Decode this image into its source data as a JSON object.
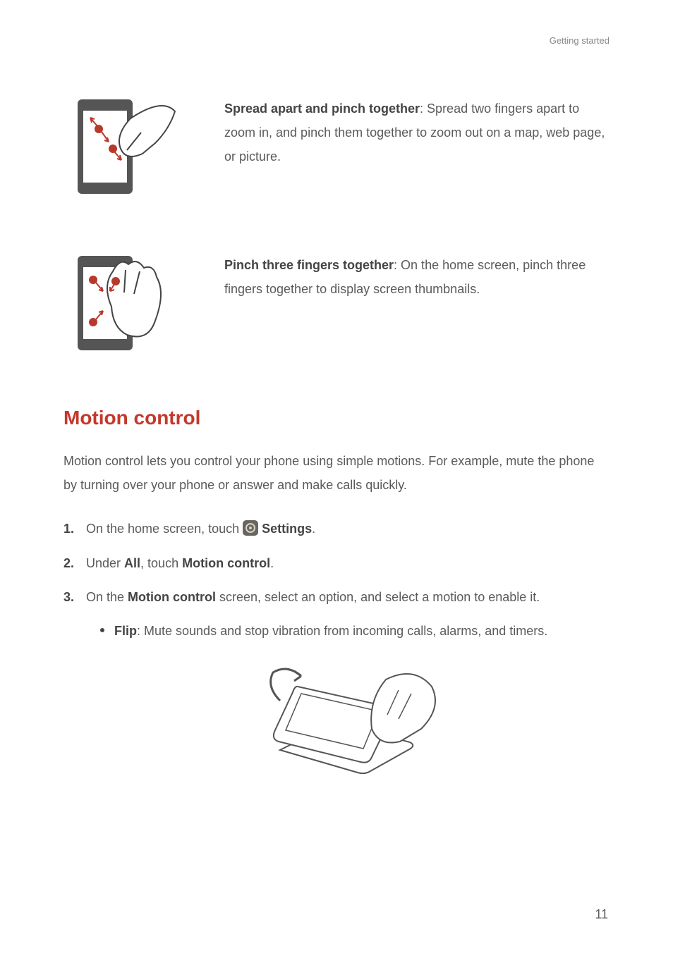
{
  "header": {
    "section_label": "Getting started"
  },
  "gestures": [
    {
      "title": "Spread apart and pinch together",
      "description": ": Spread two fingers apart to zoom in, and pinch them together to zoom out on a map, web page, or picture."
    },
    {
      "title": "Pinch three fingers together",
      "description": ": On the home screen, pinch three fingers together to display screen thumbnails."
    }
  ],
  "section": {
    "title": "Motion control",
    "intro": "Motion control lets you control your phone using simple motions. For example, mute the phone by turning over your phone or answer and make calls quickly."
  },
  "steps": {
    "one_prefix": "On the home screen, touch ",
    "one_strong": "Settings",
    "one_suffix": ".",
    "two_prefix": "Under ",
    "two_all": "All",
    "two_mid": ", touch ",
    "two_motion": "Motion control",
    "two_suffix": ".",
    "three_prefix": "On the ",
    "three_motion": "Motion control",
    "three_suffix": " screen, select an option, and select a motion to enable it.",
    "bullet_label": "Flip",
    "bullet_text": ": Mute sounds and stop vibration from incoming calls, alarms, and timers."
  },
  "page_number": "11"
}
